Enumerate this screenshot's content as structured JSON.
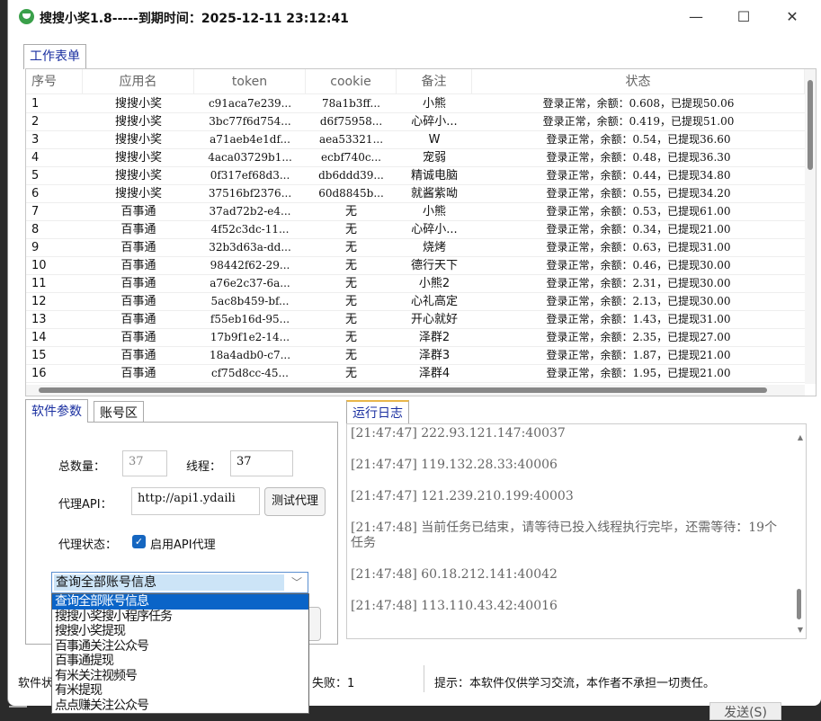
{
  "window": {
    "title": "搜搜小奖1.8-----到期时间：2025-12-11 23:12:41",
    "minimize": "—",
    "maximize": "☐",
    "close": "✕"
  },
  "top_tab": "工作表单",
  "table": {
    "headers": [
      "序号",
      "应用名",
      "token",
      "cookie",
      "备注",
      "状态"
    ],
    "rows": [
      [
        "1",
        "搜搜小奖",
        "c91aca7e239...",
        "78a1b3ff...",
        "小熊",
        "登录正常，余额：0.608，已提现50.06"
      ],
      [
        "2",
        "搜搜小奖",
        "3bc77f6d754...",
        "d6f75958...",
        "心碎小...",
        "登录正常，余额：0.419，已提现51.00"
      ],
      [
        "3",
        "搜搜小奖",
        "a71aeb4e1df...",
        "aea53321...",
        "W",
        "登录正常，余额：0.54，已提现36.60"
      ],
      [
        "4",
        "搜搜小奖",
        "4aca03729b1...",
        "ecbf740c...",
        "宠弱",
        "登录正常，余额：0.48，已提现36.30"
      ],
      [
        "5",
        "搜搜小奖",
        "0f317ef68d3...",
        "db6ddd39...",
        "精诚电脑",
        "登录正常，余额：0.44，已提现34.80"
      ],
      [
        "6",
        "搜搜小奖",
        "37516bf2376...",
        "60d8845b...",
        "就酱紫呦",
        "登录正常，余额：0.55，已提现34.20"
      ],
      [
        "7",
        "百事通",
        "37ad72b2-e4...",
        "无",
        "小熊",
        "登录正常，余额：0.53，已提现61.00"
      ],
      [
        "8",
        "百事通",
        "4f52c3dc-11...",
        "无",
        "心碎小...",
        "登录正常，余额：0.34，已提现21.00"
      ],
      [
        "9",
        "百事通",
        "32b3d63a-dd...",
        "无",
        "烧烤",
        "登录正常，余额：0.63，已提现31.00"
      ],
      [
        "10",
        "百事通",
        "98442f62-29...",
        "无",
        "德行天下",
        "登录正常，余额：0.46，已提现30.00"
      ],
      [
        "11",
        "百事通",
        "a76e2c37-6a...",
        "无",
        "小熊2",
        "登录正常，余额：2.31，已提现30.00"
      ],
      [
        "12",
        "百事通",
        "5ac8b459-bf...",
        "无",
        "心礼高定",
        "登录正常，余额：2.13，已提现30.00"
      ],
      [
        "13",
        "百事通",
        "f55eb16d-95...",
        "无",
        "开心就好",
        "登录正常，余额：1.43，已提现31.00"
      ],
      [
        "14",
        "百事通",
        "17b9f1e2-14...",
        "无",
        "泽群2",
        "登录正常，余额：2.35，已提现27.00"
      ],
      [
        "15",
        "百事通",
        "18a4adb0-c7...",
        "无",
        "泽群3",
        "登录正常，余额：1.87，已提现21.00"
      ],
      [
        "16",
        "百事通",
        "cf75d8cc-45...",
        "无",
        "泽群4",
        "登录正常，余额：1.95，已提现21.00"
      ]
    ]
  },
  "settings": {
    "tab_params": "软件参数",
    "tab_accounts": "账号区",
    "total_label": "总数量：",
    "total_value": "37",
    "threads_label": "线程：",
    "threads_value": "37",
    "proxy_api_label": "代理API：",
    "proxy_api_value": "http://api1.ydaili",
    "test_proxy": "测试代理",
    "proxy_status_label": "代理状态：",
    "enable_proxy": "启用API代理",
    "enable_proxy_checked": true
  },
  "task_select": {
    "selected": "查询全部账号信息",
    "options": [
      "查询全部账号信息",
      "搜搜小奖搜小程序任务",
      "搜搜小奖提现",
      "百事通关注公众号",
      "百事通提现",
      "有米关注视频号",
      "有米提现",
      "点点赚关注公众号"
    ]
  },
  "log": {
    "tab": "运行日志",
    "lines": [
      "[21:47:47] 222.93.121.147:40037",
      "[21:47:47] 119.132.28.33:40006",
      "[21:47:47] 121.239.210.199:40003",
      "[21:47:48] 当前任务已结束，请等待已投入线程执行完毕，还需等待：19个任务",
      "[21:47:48] 60.18.212.141:40042",
      "[21:47:48] 113.110.43.42:40016"
    ]
  },
  "statusbar": {
    "software_status": "软件状",
    "fail": "失败：1",
    "tip": "提示：本软件仅供学习交流，本作者不承担一切责任。"
  },
  "background": {
    "send_button": "发送(S)"
  }
}
